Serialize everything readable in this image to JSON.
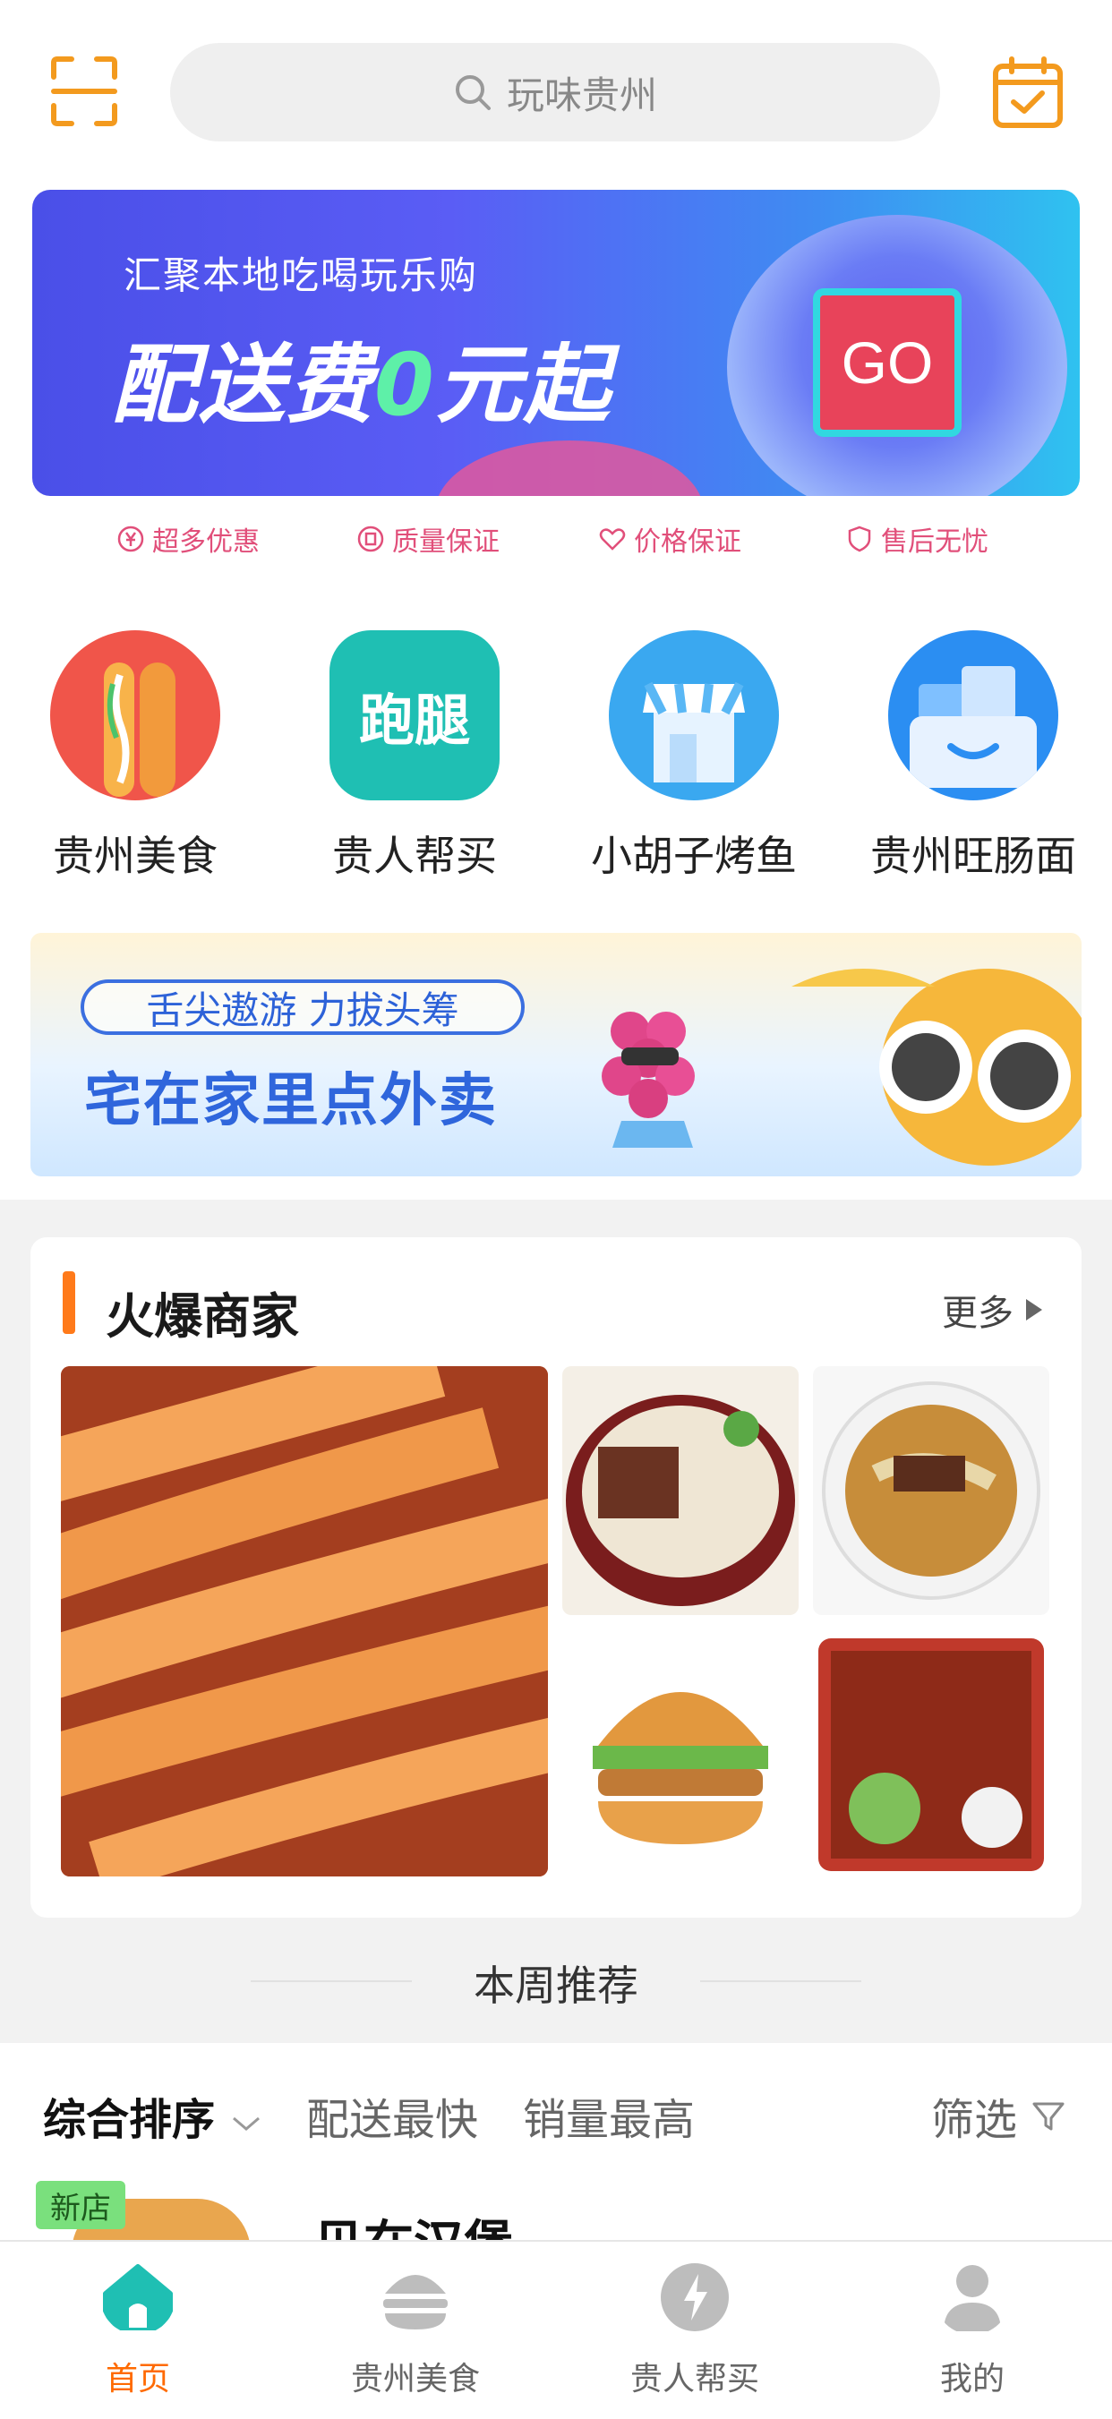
{
  "header": {
    "search_placeholder": "玩味贵州"
  },
  "banner_top": {
    "subtitle": "汇聚本地吃喝玩乐购",
    "headline_a": "配送费",
    "headline_b": "0",
    "headline_c": "元起",
    "button": "GO"
  },
  "guarantees": [
    "超多优惠",
    "质量保证",
    "价格保证",
    "售后无忧"
  ],
  "categories": [
    "贵州美食",
    "贵人帮买",
    "小胡子烤鱼",
    "贵州旺肠面"
  ],
  "category_icon_text": "跑腿",
  "banner_promo": {
    "slogan": "舌尖遨游 力拔头筹",
    "headline": "宅在家里点外卖"
  },
  "hot_merchants": {
    "title": "火爆商家",
    "more": "更多"
  },
  "weekly": {
    "title": "本周推荐"
  },
  "sort": {
    "items": [
      "综合排序",
      "配送最快",
      "销量最高"
    ],
    "filter": "筛选"
  },
  "listing": {
    "badge": "新店",
    "name": "贝在汉堡"
  },
  "tabs": [
    "首页",
    "贵州美食",
    "贵人帮买",
    "我的"
  ],
  "colors": {
    "accent": "#ff7a1a",
    "active_tab": "#ff6a00",
    "teal": "#1fbfb3",
    "guarantee": "#e14f7a"
  }
}
